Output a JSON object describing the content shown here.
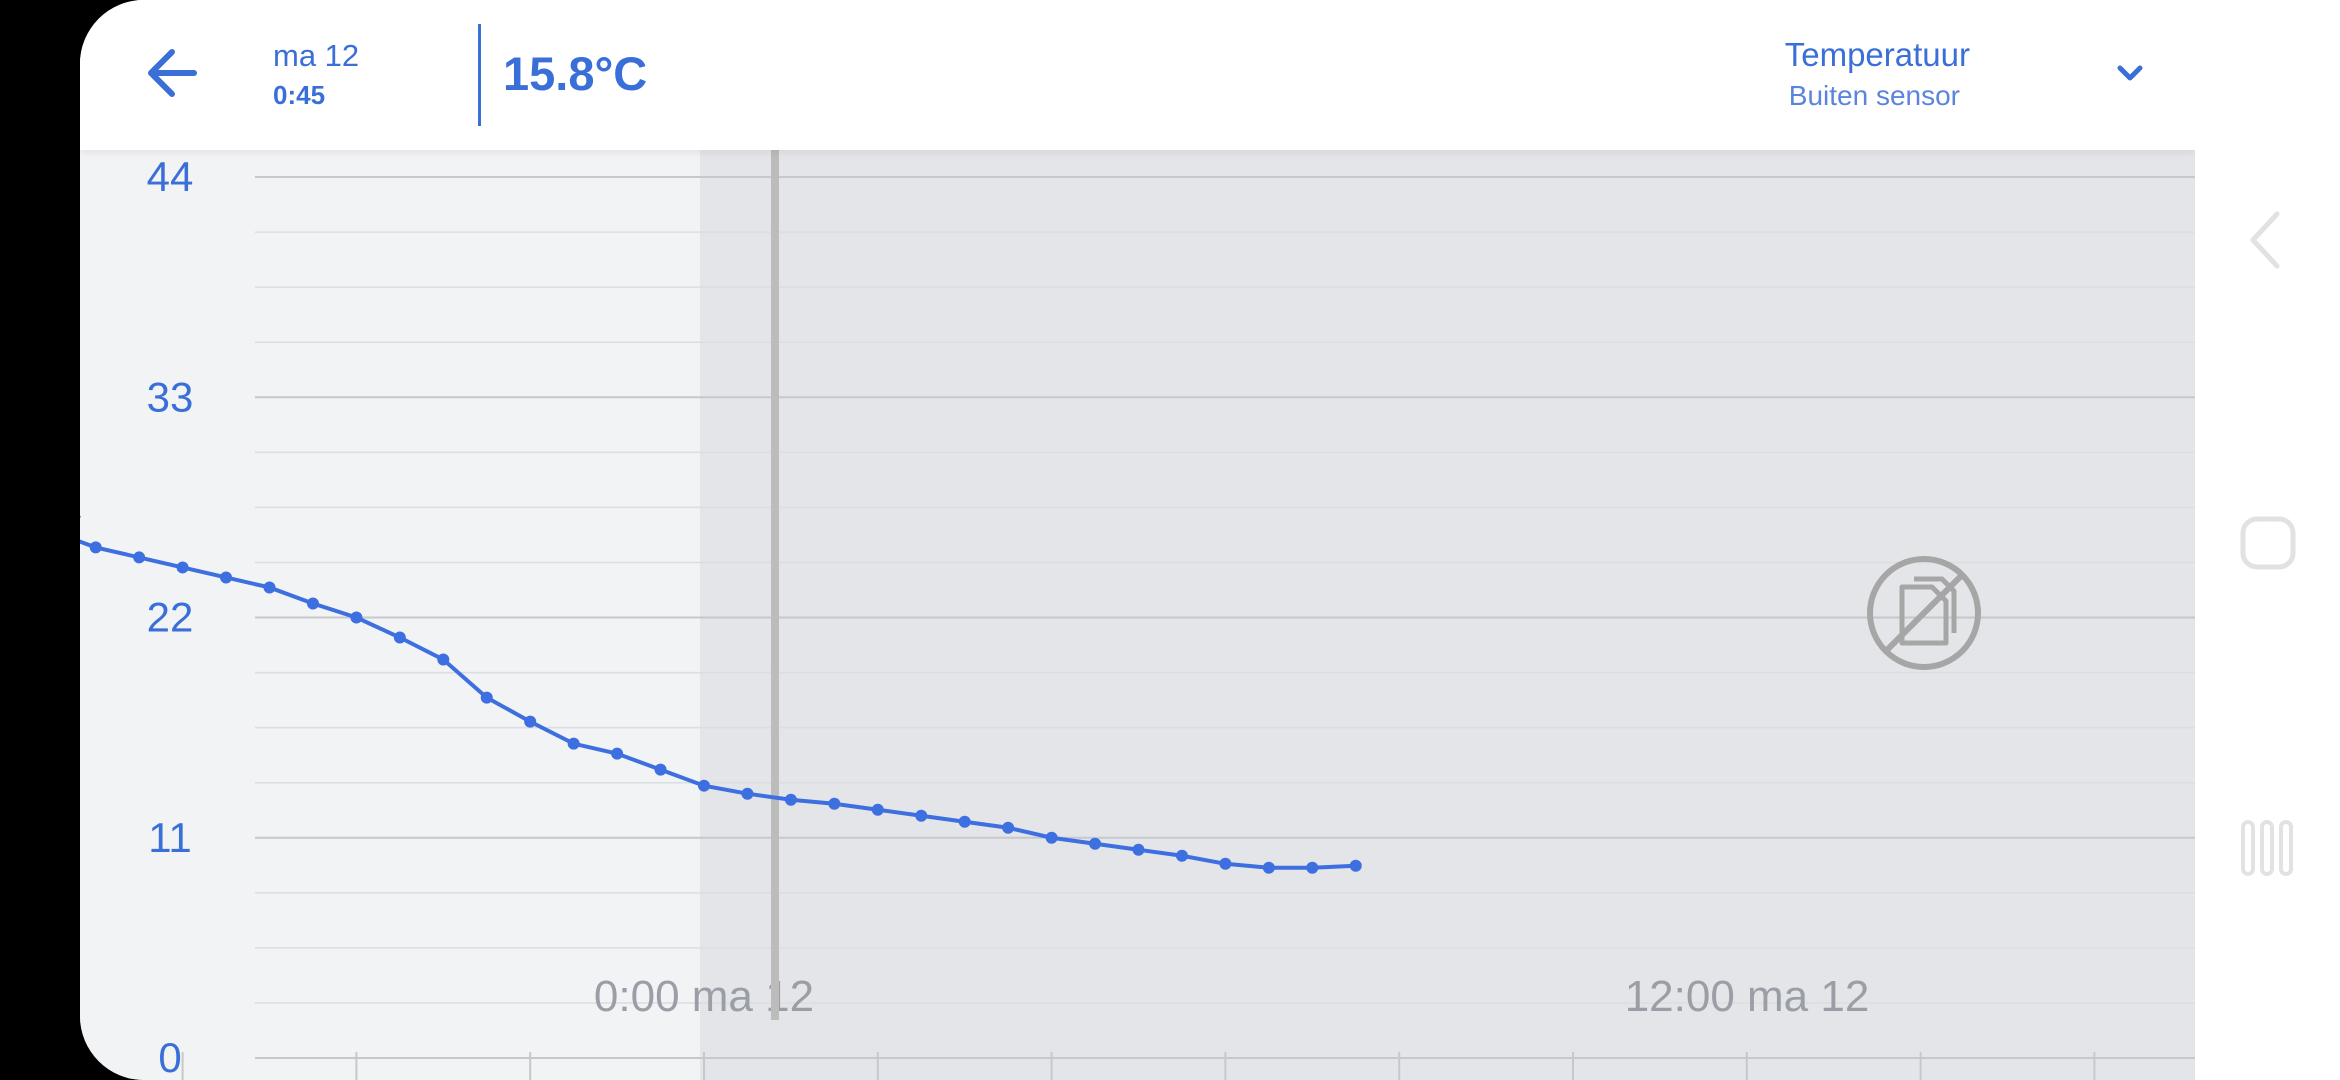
{
  "header": {
    "date": "ma 12",
    "time": "0:45",
    "current_value": "15.8°C",
    "sensor_title": "Temperatuur",
    "sensor_subtitle": "Buiten sensor"
  },
  "colors": {
    "accent": "#3a6fd8",
    "line": "#3d6fe0",
    "gridline": "#c6c8cc",
    "no_data_icon": "#a6a6a6"
  },
  "icons": {
    "back": "arrow-left-icon",
    "dropdown": "chevron-down-icon",
    "no_data": "no-data-icon",
    "nav_back": "nav-back-icon",
    "nav_home": "nav-home-icon",
    "nav_recents": "nav-recents-icon"
  },
  "chart_data": {
    "type": "line",
    "yticks": [
      0,
      11,
      22,
      33,
      44
    ],
    "ylim": [
      0,
      44
    ],
    "x_labels": [
      "0:00 ma 12",
      "12:00 ma 12"
    ],
    "x_unit": "hours relative to 0:00 ma 12",
    "selected_time": "0:45",
    "grid": true,
    "series": [
      {
        "x": [
          -7.5,
          -7.0,
          -6.5,
          -6.0,
          -5.5,
          -5.0,
          -4.5,
          -4.0,
          -3.5,
          -3.0,
          -2.5,
          -2.0,
          -1.5,
          -1.0,
          -0.5,
          0.0,
          0.5,
          1.0,
          1.5,
          2.0,
          2.5,
          3.0,
          3.5,
          4.0,
          4.5,
          5.0,
          5.5,
          6.0,
          6.5,
          7.0,
          7.5
        ],
        "values": [
          26.3,
          25.5,
          25.0,
          24.5,
          24.0,
          23.5,
          22.7,
          22.0,
          21.0,
          19.9,
          18.0,
          16.8,
          15.7,
          15.2,
          14.4,
          13.6,
          13.2,
          12.9,
          12.7,
          12.4,
          12.1,
          11.8,
          11.5,
          11.0,
          10.7,
          10.4,
          10.1,
          9.7,
          9.5,
          9.5,
          9.6
        ]
      }
    ],
    "line_start_value": 27.1
  }
}
